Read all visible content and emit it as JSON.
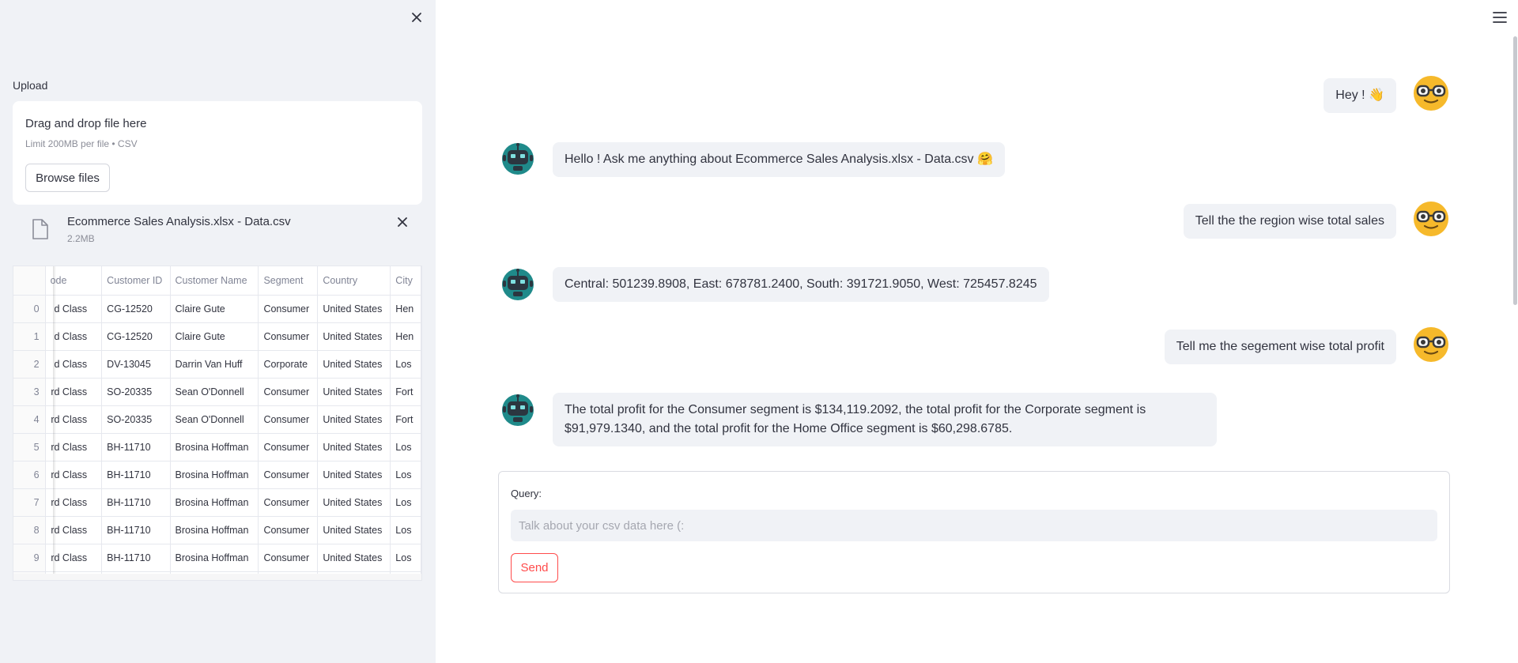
{
  "sidebar": {
    "upload_label": "Upload",
    "dropzone": {
      "title": "Drag and drop file here",
      "limit": "Limit 200MB per file • CSV",
      "browse_label": "Browse files"
    },
    "file": {
      "name": "Ecommerce Sales Analysis.xlsx - Data.csv",
      "size": "2.2MB"
    },
    "dataframe": {
      "columns": [
        "",
        "ode",
        "Customer ID",
        "Customer Name",
        "Segment",
        "Country",
        "City"
      ],
      "rows": [
        [
          "0",
          "d Class",
          "CG-12520",
          "Claire Gute",
          "Consumer",
          "United States",
          "Hen"
        ],
        [
          "1",
          "d Class",
          "CG-12520",
          "Claire Gute",
          "Consumer",
          "United States",
          "Hen"
        ],
        [
          "2",
          "d Class",
          "DV-13045",
          "Darrin Van Huff",
          "Corporate",
          "United States",
          "Los"
        ],
        [
          "3",
          "rd Class",
          "SO-20335",
          "Sean O'Donnell",
          "Consumer",
          "United States",
          "Fort"
        ],
        [
          "4",
          "rd Class",
          "SO-20335",
          "Sean O'Donnell",
          "Consumer",
          "United States",
          "Fort"
        ],
        [
          "5",
          "rd Class",
          "BH-11710",
          "Brosina Hoffman",
          "Consumer",
          "United States",
          "Los"
        ],
        [
          "6",
          "rd Class",
          "BH-11710",
          "Brosina Hoffman",
          "Consumer",
          "United States",
          "Los"
        ],
        [
          "7",
          "rd Class",
          "BH-11710",
          "Brosina Hoffman",
          "Consumer",
          "United States",
          "Los"
        ],
        [
          "8",
          "rd Class",
          "BH-11710",
          "Brosina Hoffman",
          "Consumer",
          "United States",
          "Los"
        ],
        [
          "9",
          "rd Class",
          "BH-11710",
          "Brosina Hoffman",
          "Consumer",
          "United States",
          "Los"
        ]
      ]
    }
  },
  "chat": {
    "messages": [
      {
        "role": "user",
        "text": "Hey ! 👋"
      },
      {
        "role": "bot",
        "text": "Hello ! Ask me anything about Ecommerce Sales Analysis.xlsx - Data.csv 🤗"
      },
      {
        "role": "user",
        "text": "Tell the the region wise total sales"
      },
      {
        "role": "bot",
        "text": "Central: 501239.8908, East: 678781.2400, South: 391721.9050, West: 725457.8245"
      },
      {
        "role": "user",
        "text": "Tell me the segement wise total profit"
      },
      {
        "role": "bot",
        "text": "The total profit for the Consumer segment is $134,119.2092, the total profit for the Corporate segment is $91,979.1340, and the total profit for the Home Office segment is $60,298.6785."
      }
    ]
  },
  "form": {
    "query_label": "Query:",
    "placeholder": "Talk about your csv data here (:",
    "value": "",
    "send_label": "Send"
  },
  "colors": {
    "accent": "#ff4b4b",
    "sidebar_bg": "#f0f2f6",
    "bubble_bg": "#f0f2f6",
    "user_avatar": "#f6b92b",
    "bot_avatar": "#1f8a8a"
  },
  "icons": {
    "sidebar_close": "close-icon",
    "file": "file-icon",
    "file_remove": "close-icon",
    "menu": "hamburger-menu-icon",
    "user_avatar": "nerd-face-avatar",
    "bot_avatar": "robot-avatar"
  }
}
